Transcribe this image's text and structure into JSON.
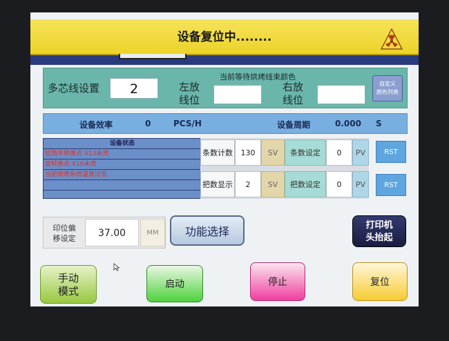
{
  "header": {
    "title": "设备复位中........",
    "logo_icon": "radiation-triangle-icon"
  },
  "settings": {
    "multicore_label": "多芯线设置",
    "multicore_value": "2",
    "current_color_label": "当前等待烘烤线束颜色",
    "left_pos_label_1": "左放",
    "left_pos_label_2": "线位",
    "left_pos_value": "",
    "right_pos_label_1": "右放",
    "right_pos_label_2": "线位",
    "right_pos_value": "",
    "custom_color_button_1": "自定义",
    "custom_color_button_2": "颜色列表"
  },
  "efficiency": {
    "efficiency_label": "设备效率",
    "efficiency_value": "0",
    "efficiency_unit": "PCS/H",
    "cycle_label": "设备周期",
    "cycle_value": "0.000",
    "cycle_unit": "S"
  },
  "status_panel": {
    "title": "设备状态",
    "lines": [
      "铝箔半移推点 X13未亮",
      "旋转推点 X16未亮",
      "当前烘烤系统温度过低",
      "",
      ""
    ]
  },
  "counters": {
    "rows": [
      {
        "label": "条数计数",
        "value": "130",
        "sv": "SV",
        "set_label": "条数设定",
        "set_value": "0",
        "pv": "PV",
        "rst": "RST"
      },
      {
        "label": "把数显示",
        "value": "2",
        "sv": "SV",
        "set_label": "把数设定",
        "set_value": "0",
        "pv": "PV",
        "rst": "RST"
      }
    ]
  },
  "offset": {
    "label_1": "印位偏",
    "label_2": "移设定",
    "value": "37.00",
    "unit": "MM"
  },
  "buttons": {
    "function_select": "功能选择",
    "printer_1": "打印机",
    "printer_2": "头抬起",
    "manual_1": "手动",
    "manual_2": "模式",
    "start": "启动",
    "stop": "停止",
    "reset": "复位"
  }
}
